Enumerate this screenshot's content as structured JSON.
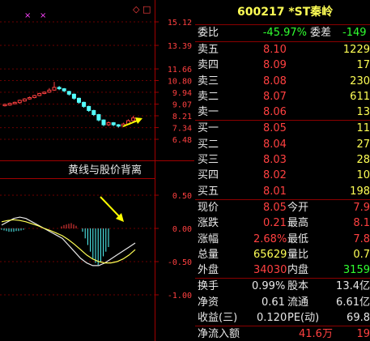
{
  "chart_axis": {
    "price_ticks": [
      "15.12",
      "13.39",
      "11.66",
      "10.80",
      "9.94",
      "9.07",
      "8.21",
      "7.34",
      "6.48"
    ],
    "macd_ticks": [
      "0.50",
      "0.00",
      "-0.50",
      "-1.00"
    ],
    "annotation": "黄线与股价背离"
  },
  "chart_data": {
    "type": "candlestick",
    "price_range": [
      6.48,
      15.12
    ],
    "macd_range": [
      -1.2,
      0.6
    ],
    "candles": [
      {
        "o": 8.95,
        "c": 9.05,
        "h": 9.1,
        "l": 8.9
      },
      {
        "o": 9.0,
        "c": 9.12,
        "h": 9.18,
        "l": 8.95
      },
      {
        "o": 9.1,
        "c": 9.2,
        "h": 9.25,
        "l": 9.05
      },
      {
        "o": 9.18,
        "c": 9.35,
        "h": 9.4,
        "l": 9.1
      },
      {
        "o": 9.3,
        "c": 9.45,
        "h": 9.5,
        "l": 9.25
      },
      {
        "o": 9.45,
        "c": 9.55,
        "h": 9.62,
        "l": 9.4
      },
      {
        "o": 9.55,
        "c": 9.7,
        "h": 9.75,
        "l": 9.5
      },
      {
        "o": 9.7,
        "c": 9.85,
        "h": 9.9,
        "l": 9.65
      },
      {
        "o": 9.85,
        "c": 9.95,
        "h": 10.0,
        "l": 9.8
      },
      {
        "o": 9.95,
        "c": 10.1,
        "h": 10.25,
        "l": 9.9
      },
      {
        "o": 10.1,
        "c": 10.3,
        "h": 10.7,
        "l": 10.05
      },
      {
        "o": 10.3,
        "c": 10.2,
        "h": 10.4,
        "l": 10.1
      },
      {
        "o": 10.2,
        "c": 10.05,
        "h": 10.25,
        "l": 9.95
      },
      {
        "o": 10.0,
        "c": 9.8,
        "h": 10.05,
        "l": 9.7
      },
      {
        "o": 9.8,
        "c": 9.5,
        "h": 9.85,
        "l": 9.4
      },
      {
        "o": 9.5,
        "c": 9.2,
        "h": 9.55,
        "l": 9.1
      },
      {
        "o": 9.2,
        "c": 8.9,
        "h": 9.25,
        "l": 8.8
      },
      {
        "o": 8.9,
        "c": 8.6,
        "h": 8.95,
        "l": 8.5
      },
      {
        "o": 8.6,
        "c": 8.3,
        "h": 8.65,
        "l": 8.2
      },
      {
        "o": 8.3,
        "c": 7.9,
        "h": 8.35,
        "l": 7.8
      },
      {
        "o": 7.9,
        "c": 7.55,
        "h": 7.95,
        "l": 7.45
      },
      {
        "o": 7.55,
        "c": 7.7,
        "h": 7.8,
        "l": 7.45
      },
      {
        "o": 7.7,
        "c": 7.55,
        "h": 7.75,
        "l": 7.45
      },
      {
        "o": 7.55,
        "c": 7.45,
        "h": 7.6,
        "l": 7.35
      },
      {
        "o": 7.45,
        "c": 7.6,
        "h": 7.7,
        "l": 7.4
      },
      {
        "o": 7.6,
        "c": 7.85,
        "h": 7.95,
        "l": 7.55
      },
      {
        "o": 7.85,
        "c": 8.05,
        "h": 8.21,
        "l": 7.8
      }
    ],
    "macd_bars": [
      0.05,
      0.08,
      0.1,
      0.12,
      0.14,
      0.1,
      0.06,
      0.02,
      -0.05,
      -0.15,
      -0.25,
      -0.35,
      -0.45,
      -0.52,
      -0.55,
      -0.5,
      -0.42,
      -0.35,
      -0.28
    ],
    "dif": [
      0.05,
      0.1,
      0.15,
      0.17,
      0.15,
      0.1,
      0.05,
      0.0,
      -0.05,
      -0.1,
      -0.15,
      -0.25,
      -0.35,
      -0.45,
      -0.52,
      -0.56,
      -0.56,
      -0.52,
      -0.46,
      -0.4,
      -0.34,
      -0.28,
      -0.22
    ],
    "dea": [
      0.1,
      0.12,
      0.13,
      0.12,
      0.1,
      0.07,
      0.04,
      0.0,
      -0.03,
      -0.07,
      -0.11,
      -0.17,
      -0.24,
      -0.32,
      -0.4,
      -0.46,
      -0.5,
      -0.52,
      -0.52,
      -0.5,
      -0.46,
      -0.4,
      -0.32
    ]
  },
  "panel": {
    "title": "600217 *ST秦岭",
    "weibi": {
      "label": "委比",
      "value": "-45.97%",
      "label2": "委差",
      "value2": "-149"
    },
    "asks": [
      {
        "label": "卖五",
        "price": "8.10",
        "vol": "1229"
      },
      {
        "label": "卖四",
        "price": "8.09",
        "vol": "17"
      },
      {
        "label": "卖三",
        "price": "8.08",
        "vol": "230"
      },
      {
        "label": "卖二",
        "price": "8.07",
        "vol": "611"
      },
      {
        "label": "卖一",
        "price": "8.06",
        "vol": "13"
      }
    ],
    "bids": [
      {
        "label": "买一",
        "price": "8.05",
        "vol": "11"
      },
      {
        "label": "买二",
        "price": "8.04",
        "vol": "27"
      },
      {
        "label": "买三",
        "price": "8.03",
        "vol": "28"
      },
      {
        "label": "买四",
        "price": "8.02",
        "vol": "10"
      },
      {
        "label": "买五",
        "price": "8.01",
        "vol": "198"
      }
    ],
    "quote": [
      {
        "l1": "现价",
        "v1": "8.05",
        "l2": "今开",
        "v2": "7.9"
      },
      {
        "l1": "涨跌",
        "v1": "0.21",
        "l2": "最高",
        "v2": "8.1"
      },
      {
        "l1": "涨幅",
        "v1": "2.68%",
        "l2": "最低",
        "v2": "7.8"
      },
      {
        "l1": "总量",
        "v1": "65629",
        "l2": "量比",
        "v2": "0.7"
      },
      {
        "l1": "外盘",
        "v1": "34030",
        "l2": "内盘",
        "v2": "3159"
      }
    ],
    "stats": [
      {
        "l1": "换手",
        "v1": "0.99%",
        "l2": "股本",
        "v2": "13.4亿"
      },
      {
        "l1": "净资",
        "v1": "0.61",
        "l2": "流通",
        "v2": "6.61亿"
      },
      {
        "l1": "收益(三)",
        "v1": "0.120",
        "l2": "PE(动)",
        "v2": "69.8"
      }
    ],
    "netflow": {
      "label": "净流入额",
      "value": "41.6万",
      "extra": "19"
    }
  }
}
